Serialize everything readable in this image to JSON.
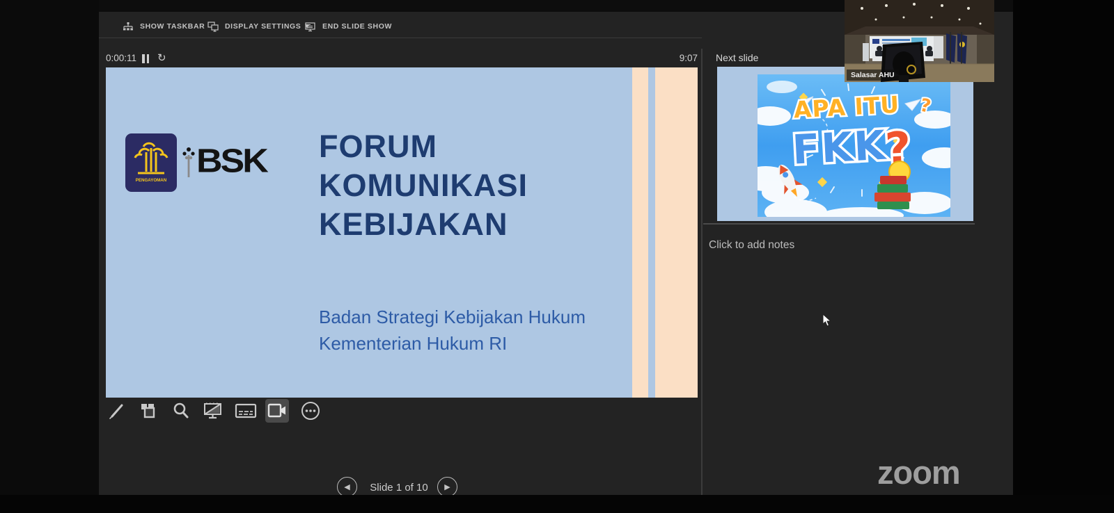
{
  "window": {
    "toolbar": {
      "show_taskbar": "SHOW TASKBAR",
      "display_settings": "DISPLAY SETTINGS ▼",
      "end_slide_show": "END SLIDE SHOW"
    },
    "timer_elapsed": "0:00:11",
    "clock": "9:07",
    "next_slide_label": "Next slide",
    "notes_placeholder": "Click to add notes",
    "slide_nav_label": "Slide 1 of 10",
    "prev_glyph": "◀",
    "next_glyph": "▶",
    "restart_glyph": "↻"
  },
  "slide": {
    "title_line1": "FORUM",
    "title_line2": "KOMUNIKASI",
    "title_line3": "KEBIJAKAN",
    "subtitle_line1": "Badan Strategi Kebijakan Hukum",
    "subtitle_line2": "Kementerian Hukum RI",
    "pengayoman_label": "PENGAYOMAN",
    "bsk_label": "BSK"
  },
  "next_slide": {
    "heading": "APA ITU",
    "big_text": "FKK",
    "question_mark": "?",
    "small_question_mark": "?"
  },
  "zoom_overlay": {
    "participant_name": "Salasar AHU",
    "watermark": "zoom"
  },
  "colors": {
    "slide_background": "#aec7e3",
    "slide_stripe_peach": "#fbdfc5",
    "title_navy": "#1e3c70",
    "subtitle_blue": "#2d5ba6",
    "preview_sky_blue": "#3f9ef0",
    "apa_itu_orange": "#ffb125",
    "fkk_blue": "#4a96ea",
    "question_red_orange": "#f0542c",
    "presenter_background": "#232323"
  }
}
